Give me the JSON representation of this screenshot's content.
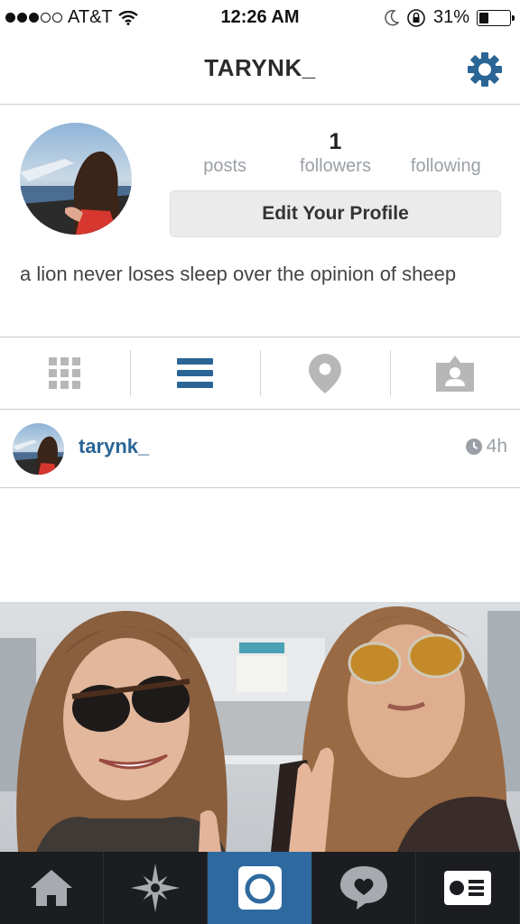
{
  "status_bar": {
    "carrier": "AT&T",
    "signal_filled": 3,
    "signal_total": 5,
    "time": "12:26 AM",
    "battery": "31%",
    "battery_level": 0.31
  },
  "header": {
    "title": "TARYNK_",
    "settings_icon": "gear-icon",
    "accent_color": "#2a6596"
  },
  "profile": {
    "stats": [
      {
        "value": "",
        "label": "posts"
      },
      {
        "value": "1",
        "label": "followers"
      },
      {
        "value": "",
        "label": "following"
      }
    ],
    "edit_button": "Edit Your Profile",
    "bio": "a lion never loses sleep over the opinion of sheep"
  },
  "view_tabs": [
    {
      "icon": "grid-icon",
      "active": false
    },
    {
      "icon": "list-icon",
      "active": true
    },
    {
      "icon": "location-pin-icon",
      "active": false
    },
    {
      "icon": "tagged-person-icon",
      "active": false
    }
  ],
  "post": {
    "username": "tarynk_",
    "time": "4h"
  },
  "tab_bar": [
    {
      "icon": "home-icon",
      "active": false
    },
    {
      "icon": "explore-star-icon",
      "active": false
    },
    {
      "icon": "camera-icon",
      "active": true
    },
    {
      "icon": "activity-heart-bubble-icon",
      "active": false
    },
    {
      "icon": "profile-card-icon",
      "active": false
    }
  ]
}
